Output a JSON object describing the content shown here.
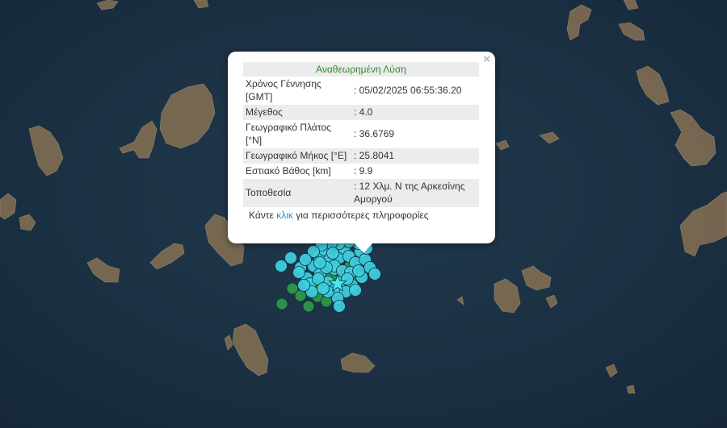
{
  "map": {
    "colors": {
      "sea": "#1c3244",
      "land": "#7b6a52",
      "quake_recent": "#3fd0e0",
      "quake_older": "#2f9a4a",
      "epicenter_star": "#4ce8ef"
    }
  },
  "popup": {
    "title": "Αναθεωρημένη Λύση",
    "close_icon": "×",
    "rows": [
      {
        "label": "Χρόνος Γέννησης [GMT]",
        "value": ": 05/02/2025 06:55:36.20"
      },
      {
        "label": "Μέγεθος",
        "value": ": 4.0"
      },
      {
        "label": "Γεωγραφικό Πλάτος [°N]",
        "value": ": 36.6769"
      },
      {
        "label": "Γεωγραφικό Μήκος [°E]",
        "value": ": 25.8041"
      },
      {
        "label": "Εστιακό Βάθος [km]",
        "value": ": 9.9"
      },
      {
        "label": "Τοποθεσία",
        "value": ": 12 Χλμ. Ν της Αρκεσίνης Αμοργού"
      }
    ],
    "more_prefix": "Κάντε",
    "more_link": "κλικ",
    "more_suffix": "για περισσότερες πληροφορίες"
  }
}
